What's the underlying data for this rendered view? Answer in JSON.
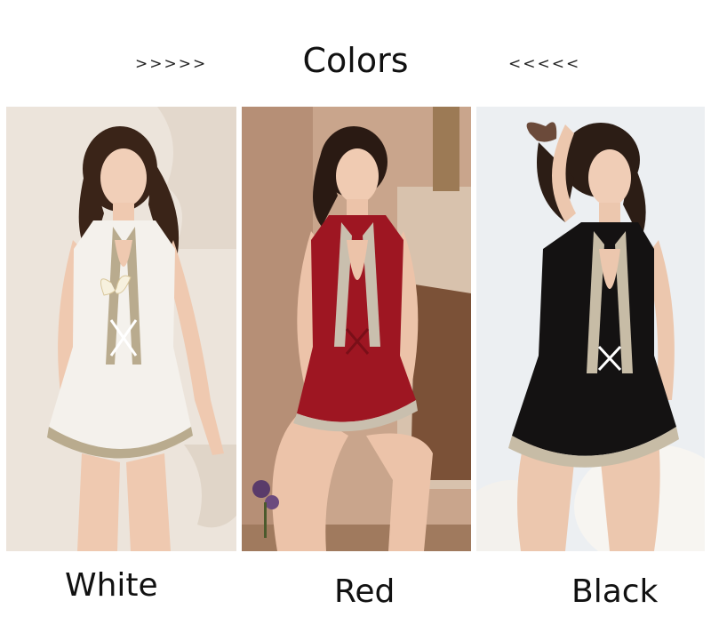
{
  "header": {
    "arrows_left": ">>>>>",
    "title": "Colors",
    "arrows_right": "<<<<<"
  },
  "variants": [
    {
      "label": "White",
      "garment_color": "#f4f1ec",
      "lace_color": "#b9ab8e",
      "bg_color": "#ece4db"
    },
    {
      "label": "Red",
      "garment_color": "#9e1622",
      "lace_color": "#c9bfae",
      "bg_color": "#c9a58c"
    },
    {
      "label": "Black",
      "garment_color": "#141212",
      "lace_color": "#c7bca6",
      "bg_color": "#eceff2"
    }
  ]
}
